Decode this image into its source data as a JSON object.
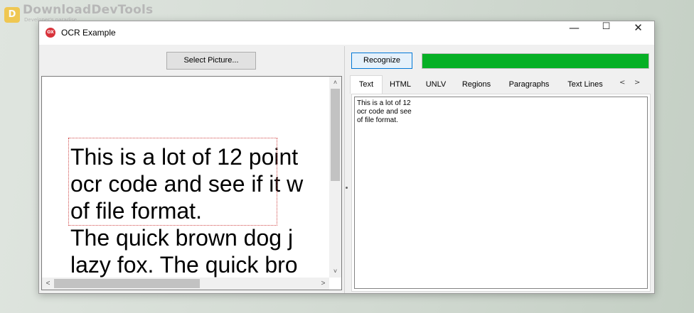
{
  "watermark": {
    "logo_glyph": "D",
    "title": "DownloadDevTools",
    "subtitle": "Developer's paradise"
  },
  "window": {
    "icon_glyph": "OX",
    "title": "OCR Example",
    "minimize_glyph": "—",
    "maximize_glyph": "☐",
    "close_glyph": "✕"
  },
  "left": {
    "select_button_label": "Select Picture...",
    "image_lines": [
      "This is a lot of 12 point",
      "ocr code and see if it w",
      "of file format.",
      "The quick brown dog j",
      "lazy fox. The quick bro"
    ],
    "scroll": {
      "up": "˄",
      "down": "˅",
      "left": "<",
      "right": ">"
    }
  },
  "right": {
    "recognize_button_label": "Recognize",
    "progress_percent": 100,
    "progress_color": "#06b025",
    "tabs": [
      "Text",
      "HTML",
      "UNLV",
      "Regions",
      "Paragraphs",
      "Text Lines"
    ],
    "active_tab": "Text",
    "tab_scroll_left": "<",
    "tab_scroll_right": ">",
    "ocr_text_lines": [
      "This is a lot of 12",
      "ocr code and see",
      "of file format."
    ]
  }
}
